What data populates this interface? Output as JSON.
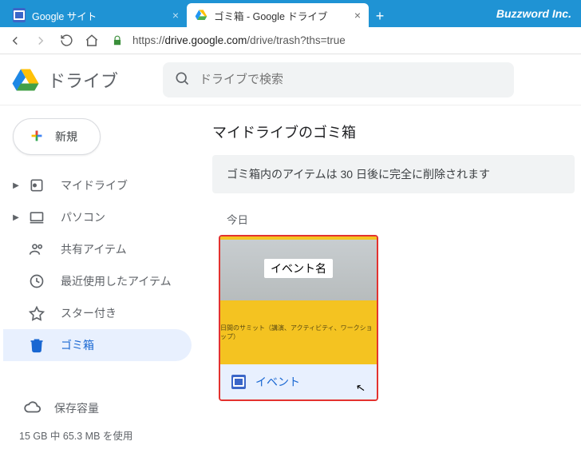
{
  "browser": {
    "brand": "Buzzword Inc.",
    "tabs": [
      {
        "title": "Google サイト",
        "active": false
      },
      {
        "title": "ゴミ箱 - Google ドライブ",
        "active": true
      }
    ],
    "url_display": "https://drive.google.com/drive/trash?ths=true",
    "url_host": "drive.google.com",
    "url_scheme": "https://",
    "url_path": "/drive/trash?ths=true"
  },
  "header": {
    "product": "ドライブ",
    "search_placeholder": "ドライブで検索"
  },
  "sidebar": {
    "new_label": "新規",
    "items": [
      {
        "label": "マイドライブ",
        "expandable": true
      },
      {
        "label": "パソコン",
        "expandable": true
      },
      {
        "label": "共有アイテム",
        "expandable": false
      },
      {
        "label": "最近使用したアイテム",
        "expandable": false
      },
      {
        "label": "スター付き",
        "expandable": false
      },
      {
        "label": "ゴミ箱",
        "expandable": false
      }
    ],
    "storage_label": "保存容量",
    "storage_text": "15 GB 中 65.3 MB を使用"
  },
  "main": {
    "title": "マイドライブのゴミ箱",
    "banner": "ゴミ箱内のアイテムは 30 日後に完全に削除されます",
    "section": "今日",
    "file": {
      "name": "イベント",
      "preview_title": "イベント名",
      "preview_sub": "日間のサミット（講演、アクティビティ、ワークショップ）"
    }
  }
}
